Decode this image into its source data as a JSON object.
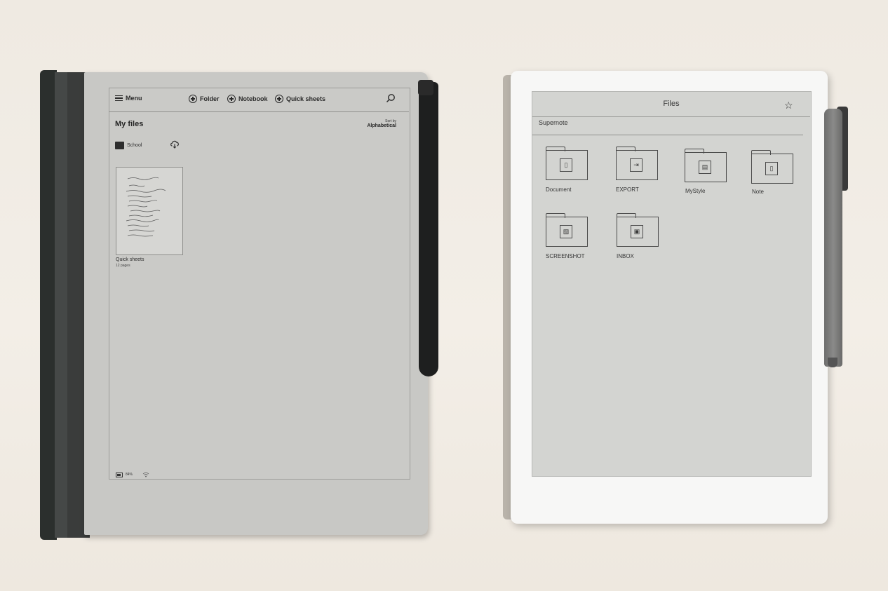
{
  "left_device": {
    "toolbar": {
      "menu_label": "Menu",
      "folder_label": "Folder",
      "notebook_label": "Notebook",
      "quick_sheets_label": "Quick sheets"
    },
    "title": "My files",
    "sort": {
      "label": "Sort by",
      "value": "Alphabetical"
    },
    "folder": {
      "name": "School"
    },
    "notebook": {
      "name": "Quick sheets",
      "pages": "12 pages"
    },
    "status": {
      "battery": "84%"
    }
  },
  "right_device": {
    "header_title": "Files",
    "breadcrumb": "Supernote",
    "folders": [
      {
        "name": "Document",
        "icon": "document-icon"
      },
      {
        "name": "EXPORT",
        "icon": "export-icon"
      },
      {
        "name": "MyStyle",
        "icon": "mystyle-icon"
      },
      {
        "name": "Note",
        "icon": "note-icon"
      },
      {
        "name": "SCREENSHOT",
        "icon": "image-icon"
      },
      {
        "name": "INBOX",
        "icon": "inbox-icon"
      }
    ]
  },
  "colors": {
    "background": "#efeae2",
    "left_screen": "#cacac7",
    "right_screen": "#d3d4d1",
    "right_bezel": "#f7f7f6"
  }
}
